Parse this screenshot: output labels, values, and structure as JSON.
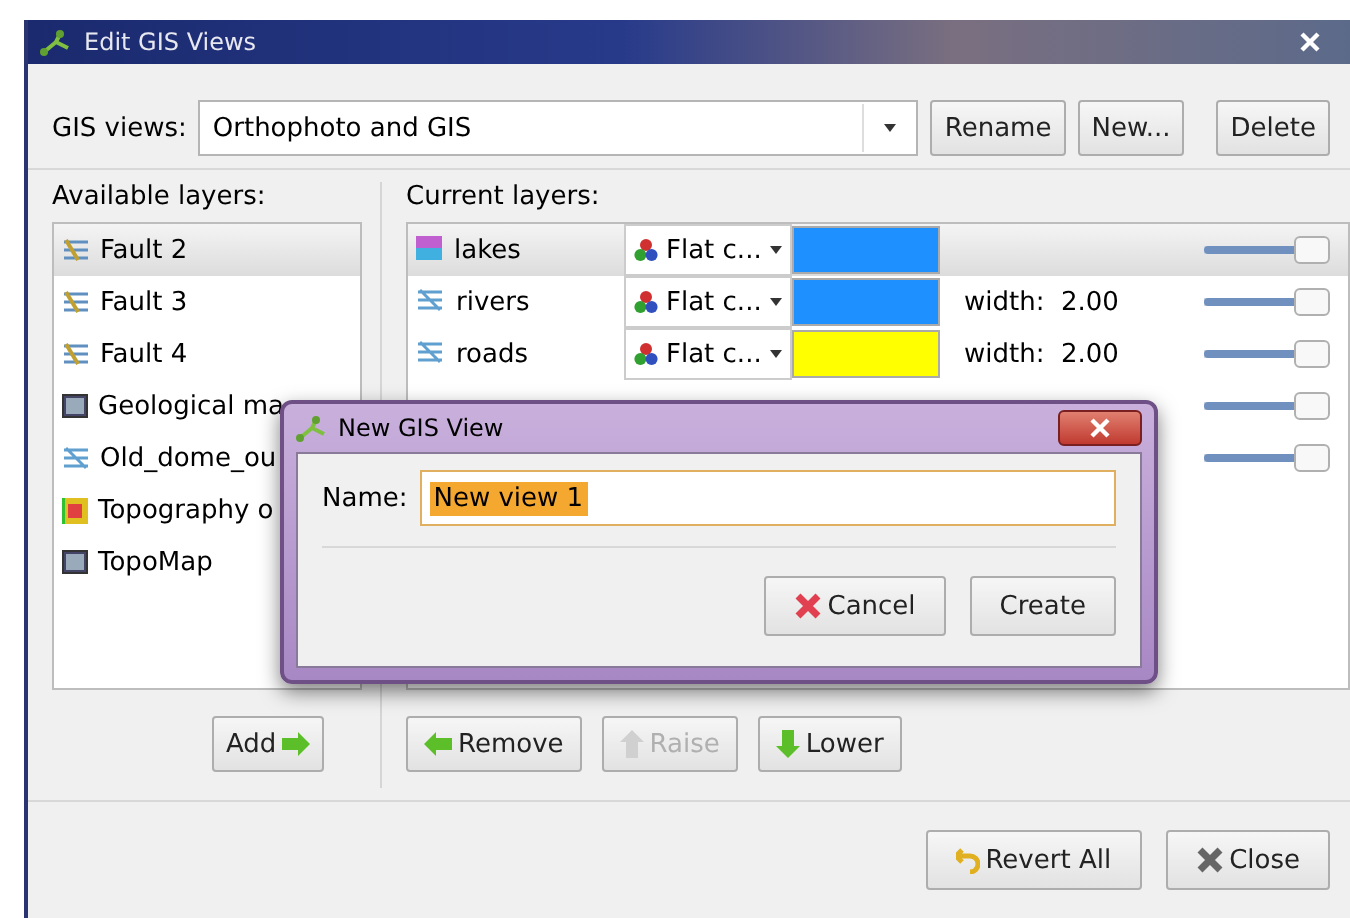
{
  "window": {
    "title": "Edit GIS Views"
  },
  "views": {
    "label": "GIS views:",
    "value": "Orthophoto and GIS",
    "buttons": [
      "Rename",
      "New...",
      "Delete"
    ]
  },
  "available": {
    "label": "Available layers:",
    "items": [
      {
        "label": "Fault 2",
        "kind": "fault",
        "selected": true
      },
      {
        "label": "Fault 3",
        "kind": "fault",
        "selected": false
      },
      {
        "label": "Fault 4",
        "kind": "fault",
        "selected": false
      },
      {
        "label": "Geological ma",
        "kind": "image",
        "selected": false
      },
      {
        "label": "Old_dome_ou",
        "kind": "line",
        "selected": false
      },
      {
        "label": "Topography o",
        "kind": "grid",
        "selected": false
      },
      {
        "label": "TopoMap",
        "kind": "image",
        "selected": false
      }
    ],
    "add_button": "Add"
  },
  "current": {
    "label": "Current layers:",
    "rows": [
      {
        "name": "lakes",
        "kind": "polygon",
        "style": "Flat c...",
        "color": "#1e90ff",
        "width": "",
        "level": 0.92,
        "selected": true
      },
      {
        "name": "rivers",
        "kind": "line",
        "style": "Flat c...",
        "color": "#1e90ff",
        "width": "width:  2.00",
        "level": 0.92,
        "selected": false
      },
      {
        "name": "roads",
        "kind": "line",
        "style": "Flat c...",
        "color": "#ffff00",
        "width": "width:  2.00",
        "level": 0.92,
        "selected": false
      },
      {
        "level": 0.92,
        "selected": false
      },
      {
        "level": 0.92,
        "selected": false
      }
    ],
    "buttons": [
      {
        "label": "Remove",
        "kind": "left",
        "disabled": false
      },
      {
        "label": "Raise",
        "kind": "up",
        "disabled": true
      },
      {
        "label": "Lower",
        "kind": "down",
        "disabled": false
      }
    ]
  },
  "footer": {
    "buttons": [
      {
        "label": "Revert All",
        "kind": "revert"
      },
      {
        "label": "Close",
        "kind": "close"
      }
    ]
  },
  "dialog": {
    "title": "New GIS View",
    "label": "Name:",
    "value": "New view 1",
    "buttons": [
      {
        "label": "Cancel",
        "kind": "cancel"
      },
      {
        "label": "Create",
        "kind": "plain"
      }
    ]
  }
}
